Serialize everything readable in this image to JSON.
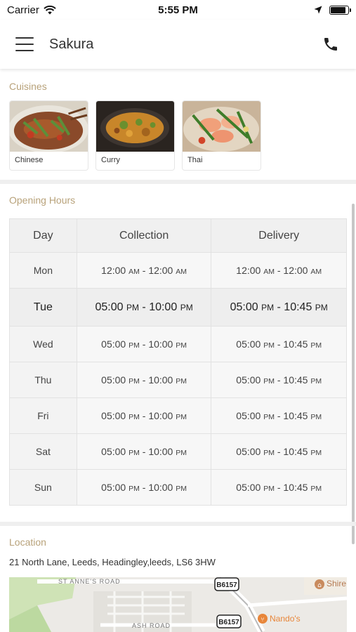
{
  "status_bar": {
    "carrier": "Carrier",
    "time": "5:55 PM"
  },
  "header": {
    "title": "Sakura"
  },
  "cuisines": {
    "title": "Cuisines",
    "items": [
      {
        "label": "Chinese",
        "image": "chinese-food-photo"
      },
      {
        "label": "Curry",
        "image": "curry-food-photo"
      },
      {
        "label": "Thai",
        "image": "thai-food-photo"
      }
    ]
  },
  "opening_hours": {
    "title": "Opening Hours",
    "columns": [
      "Day",
      "Collection",
      "Delivery"
    ],
    "rows": [
      {
        "day": "Mon",
        "col_start": "12:00",
        "col_start_ampm": "AM",
        "col_end": "12:00",
        "col_end_ampm": "AM",
        "del_start": "12:00",
        "del_start_ampm": "AM",
        "del_end": "12:00",
        "del_end_ampm": "AM"
      },
      {
        "day": "Tue",
        "col_start": "05:00",
        "col_start_ampm": "PM",
        "col_end": "10:00",
        "col_end_ampm": "PM",
        "del_start": "05:00",
        "del_start_ampm": "PM",
        "del_end": "10:45",
        "del_end_ampm": "PM"
      },
      {
        "day": "Wed",
        "col_start": "05:00",
        "col_start_ampm": "PM",
        "col_end": "10:00",
        "col_end_ampm": "PM",
        "del_start": "05:00",
        "del_start_ampm": "PM",
        "del_end": "10:45",
        "del_end_ampm": "PM"
      },
      {
        "day": "Thu",
        "col_start": "05:00",
        "col_start_ampm": "PM",
        "col_end": "10:00",
        "col_end_ampm": "PM",
        "del_start": "05:00",
        "del_start_ampm": "PM",
        "del_end": "10:45",
        "del_end_ampm": "PM"
      },
      {
        "day": "Fri",
        "col_start": "05:00",
        "col_start_ampm": "PM",
        "col_end": "10:00",
        "col_end_ampm": "PM",
        "del_start": "05:00",
        "del_start_ampm": "PM",
        "del_end": "10:45",
        "del_end_ampm": "PM"
      },
      {
        "day": "Sat",
        "col_start": "05:00",
        "col_start_ampm": "PM",
        "col_end": "10:00",
        "col_end_ampm": "PM",
        "del_start": "05:00",
        "del_start_ampm": "PM",
        "del_end": "10:45",
        "del_end_ampm": "PM"
      },
      {
        "day": "Sun",
        "col_start": "05:00",
        "col_start_ampm": "PM",
        "col_end": "10:00",
        "col_end_ampm": "PM",
        "del_start": "05:00",
        "del_start_ampm": "PM",
        "del_end": "10:45",
        "del_end_ampm": "PM"
      }
    ],
    "highlighted_day": "Tue",
    "separator": " - "
  },
  "location": {
    "title": "Location",
    "address": "21 North Lane, Leeds, Headingley,leeds, LS6 3HW",
    "map": {
      "road_labels": [
        "ST ANNE'S ROAD",
        "ASH ROAD"
      ],
      "route_badges": [
        "B6157",
        "B6157"
      ],
      "pois": [
        "Nando's",
        "Shire Prim"
      ]
    }
  },
  "colors": {
    "section_title": "#b8a27a",
    "divider": "#efefef",
    "poi_orange": "#e8863a"
  }
}
